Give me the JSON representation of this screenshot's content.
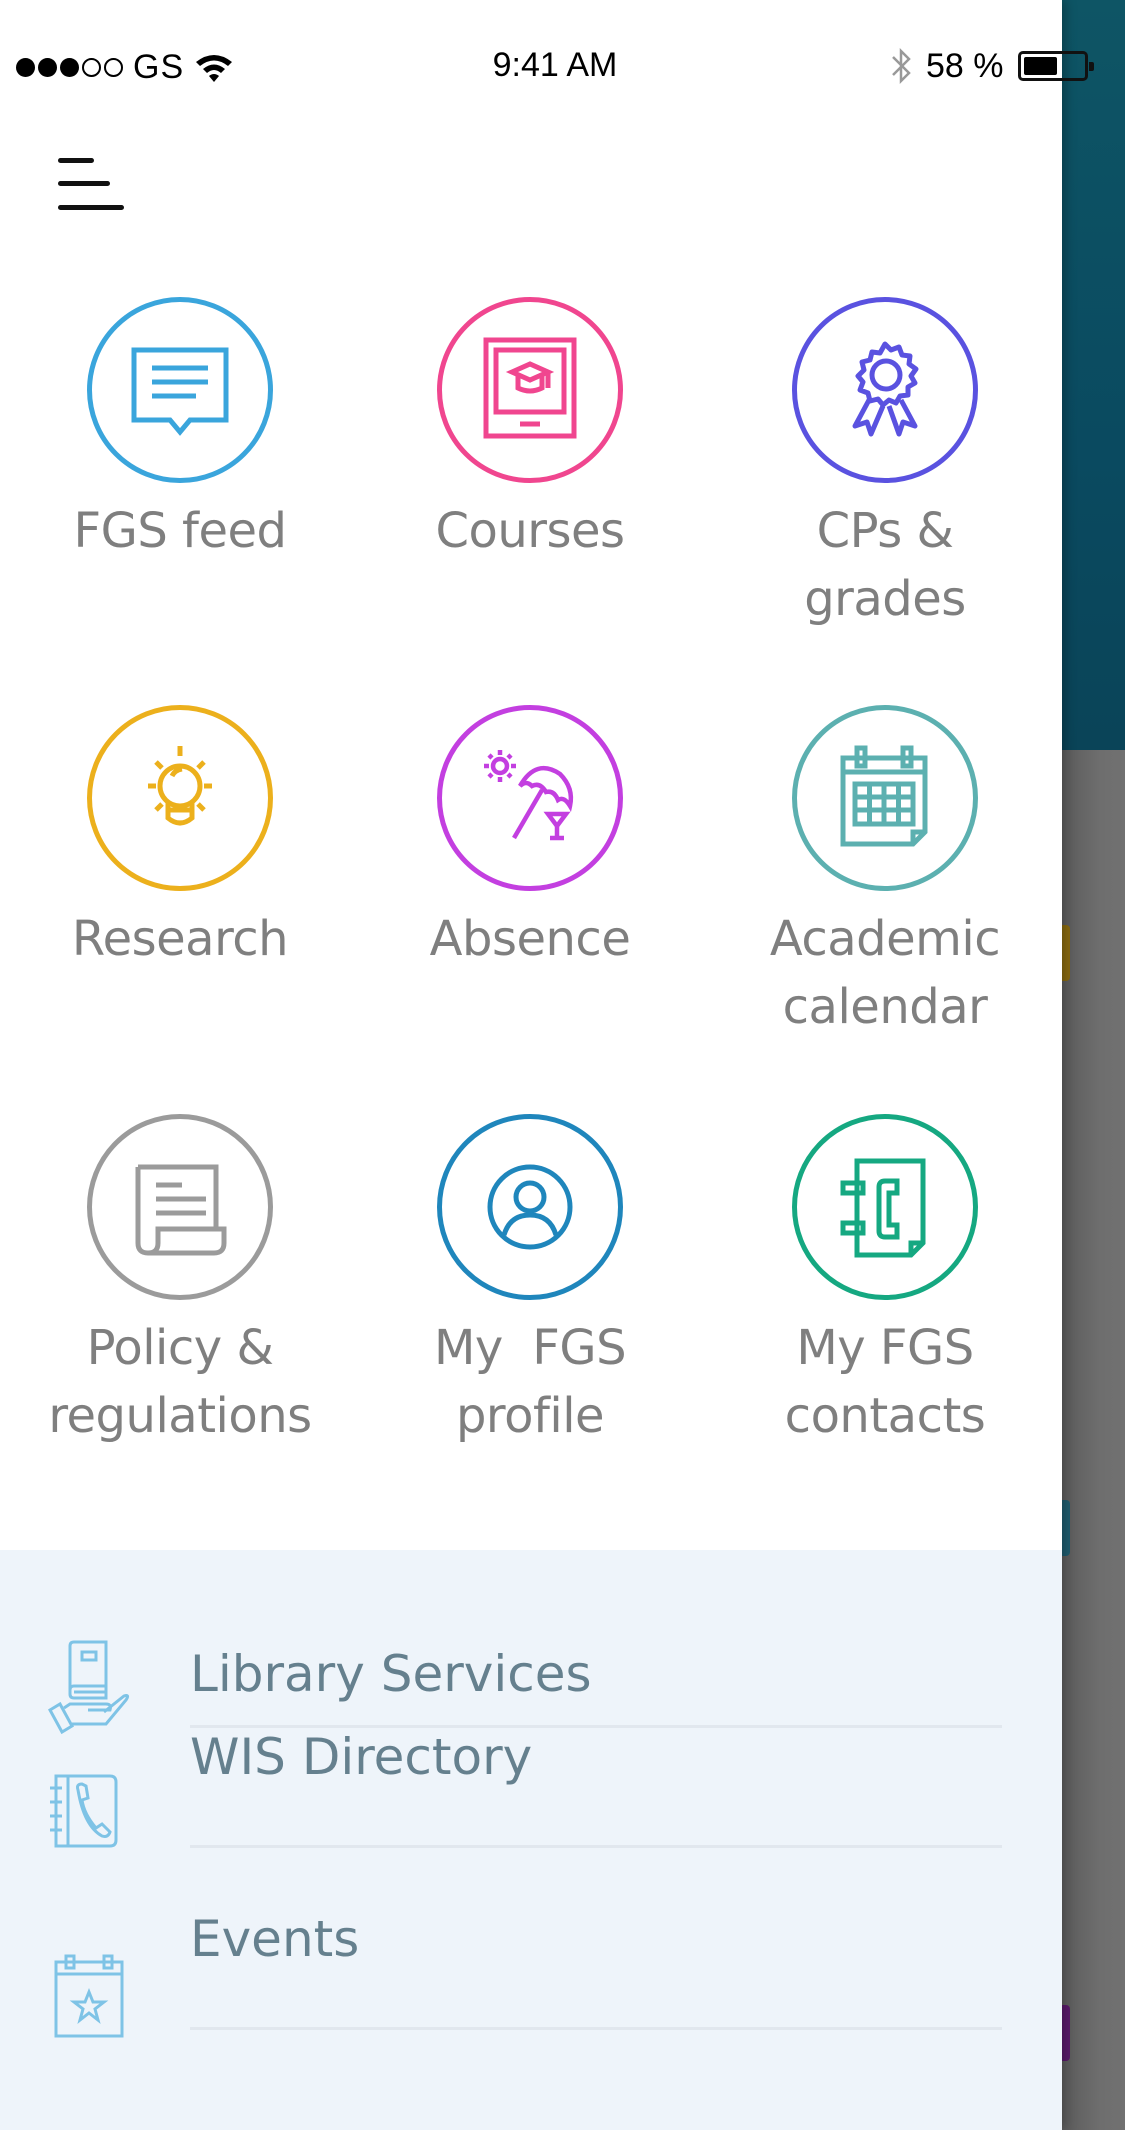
{
  "status_bar": {
    "carrier": "GS",
    "signal_bars_filled": 3,
    "signal_bars_total": 5,
    "time": "9:41 AM",
    "battery_label": "58 %",
    "battery_level": 0.58,
    "icons": [
      "wifi-icon",
      "bluetooth-icon",
      "battery-icon"
    ]
  },
  "header": {
    "menu_icon": "hamburger-menu-icon"
  },
  "grid": {
    "tiles": [
      {
        "label": "FGS feed",
        "icon": "message-feed-icon",
        "color": "#3aa5dc"
      },
      {
        "label": "Courses",
        "icon": "course-monitor-icon",
        "color": "#f0468f"
      },
      {
        "label": "CPs &\ngrades",
        "label_line1": "CPs &",
        "label_line2": "grades",
        "icon": "award-ribbon-icon",
        "color": "#5a52e0"
      },
      {
        "label": "Research",
        "icon": "lightbulb-icon",
        "color": "#ecb01c"
      },
      {
        "label": "Absence",
        "icon": "beach-umbrella-icon",
        "color": "#c33fe0"
      },
      {
        "label": "Academic calendar",
        "label_line1": "Academic",
        "label_line2": "calendar",
        "icon": "calendar-icon",
        "color": "#5cb0b0"
      },
      {
        "label": "Policy & regulations",
        "label_line1": "Policy &",
        "label_line2": "regulations",
        "icon": "scroll-document-icon",
        "color": "#9b9b9b"
      },
      {
        "label": "My FGS profile",
        "label_line1": "My  FGS",
        "label_line2": "profile",
        "icon": "user-profile-icon",
        "color": "#1f86bc"
      },
      {
        "label": "My FGS contacts",
        "label_line1": "My FGS",
        "label_line2": "contacts",
        "icon": "contact-book-icon",
        "color": "#15a881"
      }
    ]
  },
  "list": {
    "accent_color": "#7ec3e6",
    "items": [
      {
        "label": "Library Services",
        "icon": "library-book-hand-icon"
      },
      {
        "label": "WIS Directory",
        "icon": "phone-directory-icon"
      },
      {
        "label": "Events",
        "icon": "calendar-star-icon"
      }
    ]
  }
}
